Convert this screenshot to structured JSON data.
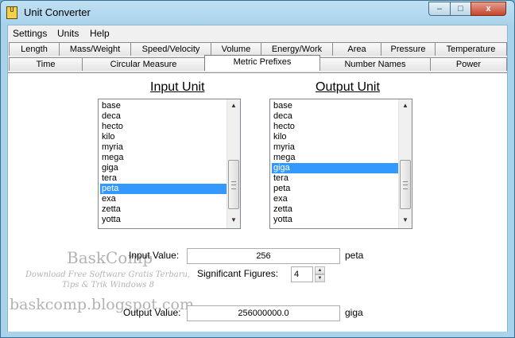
{
  "window": {
    "title": "Unit Converter",
    "app_icon_text": "U",
    "min_glyph": "‒",
    "max_glyph": "□",
    "close_glyph": "x"
  },
  "menu": [
    "Settings",
    "Units",
    "Help"
  ],
  "tabs_row1": [
    "Length",
    "Mass/Weight",
    "Speed/Velocity",
    "Volume",
    "Energy/Work",
    "Area",
    "Pressure",
    "Temperature"
  ],
  "tabs_row2": [
    "Time",
    "Circular Measure",
    "Metric Prefixes",
    "Number Names",
    "Power"
  ],
  "active_tab": "Metric Prefixes",
  "input_unit": {
    "heading": "Input Unit",
    "items": [
      "base",
      "deca",
      "hecto",
      "kilo",
      "myria",
      "mega",
      "giga",
      "tera",
      "peta",
      "exa",
      "zetta",
      "yotta"
    ],
    "selected": "peta"
  },
  "output_unit": {
    "heading": "Output Unit",
    "items": [
      "base",
      "deca",
      "hecto",
      "kilo",
      "myria",
      "mega",
      "giga",
      "tera",
      "peta",
      "exa",
      "zetta",
      "yotta"
    ],
    "selected": "giga"
  },
  "input_value": {
    "label": "Input Value:",
    "value": "256",
    "unit": "peta"
  },
  "significant_figures": {
    "label": "Significant Figures:",
    "value": "4"
  },
  "output_value": {
    "label": "Output Value:",
    "value": "256000000.0",
    "unit": "giga"
  },
  "scroll_arrows": {
    "up": "▲",
    "down": "▼"
  },
  "spin_arrows": {
    "up": "▲",
    "down": "▼"
  },
  "watermark": {
    "name": "BaskComp",
    "line1": "Download Free Software Gratis Terbaru,",
    "line2": "Tips & Trik Windows 8",
    "site": "baskcomp.blogspot.com"
  }
}
